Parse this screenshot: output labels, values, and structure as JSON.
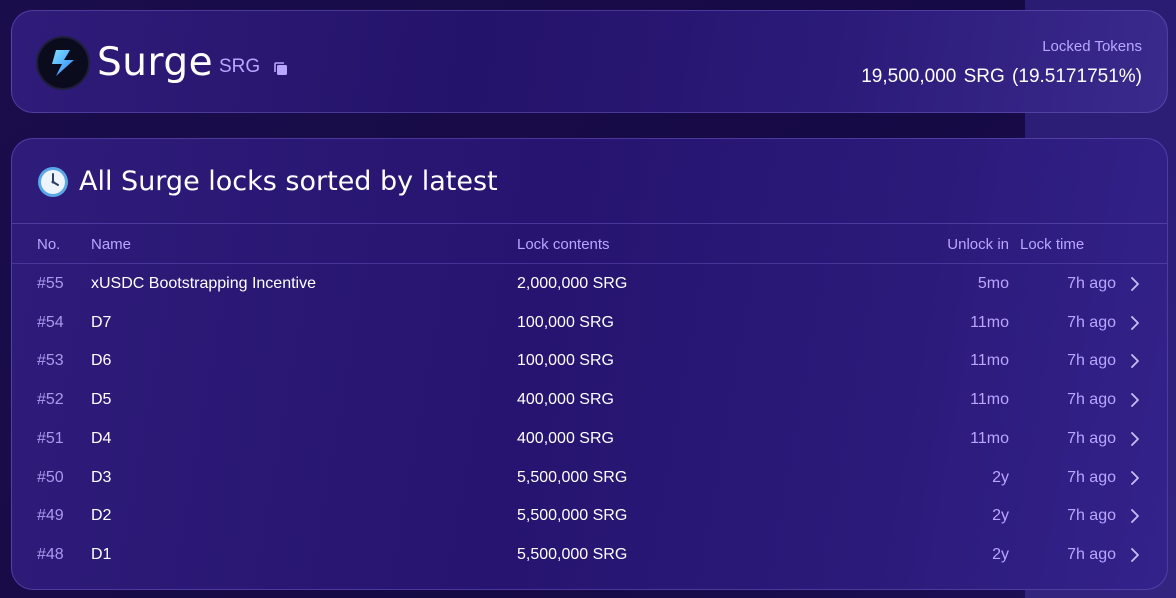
{
  "header": {
    "title": "Surge",
    "symbol": "SRG",
    "locked_label": "Locked Tokens",
    "locked_value": "19,500,000  SRG  (19.5171751%)"
  },
  "section": {
    "title": "All Surge locks sorted by latest"
  },
  "table": {
    "columns": {
      "no": "No.",
      "name": "Name",
      "lock_contents": "Lock contents",
      "unlock_in": "Unlock in",
      "lock_time": "Lock time"
    },
    "rows": [
      {
        "no": "#55",
        "name": "xUSDC Bootstrapping Incentive",
        "contents": "2,000,000 SRG",
        "unlock": "5mo",
        "time": "7h ago"
      },
      {
        "no": "#54",
        "name": "D7",
        "contents": "100,000 SRG",
        "unlock": "11mo",
        "time": "7h ago"
      },
      {
        "no": "#53",
        "name": "D6",
        "contents": "100,000 SRG",
        "unlock": "11mo",
        "time": "7h ago"
      },
      {
        "no": "#52",
        "name": "D5",
        "contents": "400,000 SRG",
        "unlock": "11mo",
        "time": "7h ago"
      },
      {
        "no": "#51",
        "name": "D4",
        "contents": "400,000 SRG",
        "unlock": "11mo",
        "time": "7h ago"
      },
      {
        "no": "#50",
        "name": "D3",
        "contents": "5,500,000 SRG",
        "unlock": "2y",
        "time": "7h ago"
      },
      {
        "no": "#49",
        "name": "D2",
        "contents": "5,500,000 SRG",
        "unlock": "2y",
        "time": "7h ago"
      },
      {
        "no": "#48",
        "name": "D1",
        "contents": "5,500,000 SRG",
        "unlock": "2y",
        "time": "7h ago"
      }
    ]
  },
  "icons": {
    "logo": "surge-logo-icon",
    "copy": "copy-icon",
    "clock": "clock-icon",
    "row_arrow": "chevron-right-icon"
  },
  "colors": {
    "accent": "#b9a6ff",
    "logo_blue": "#4fb6ff"
  }
}
